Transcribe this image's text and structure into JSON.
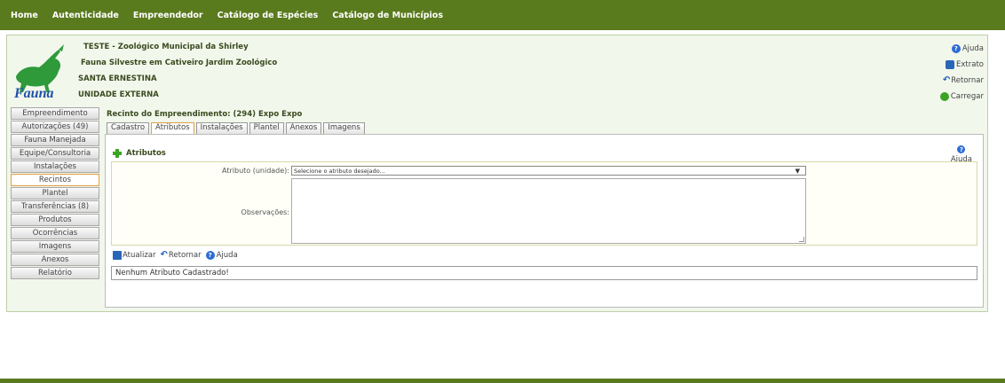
{
  "nav": [
    "Home",
    "Autenticidade",
    "Empreendedor",
    "Catálogo de Espécies",
    "Catálogo de Municípios"
  ],
  "header": {
    "line1": "TESTE - Zoológico Municipal da Shirley",
    "line2": "Fauna Silvestre em Cativeiro Jardim Zoológico",
    "line3": "SANTA ERNESTINA",
    "line4": "UNIDADE EXTERNA",
    "logo_text": "Fauna"
  },
  "right_actions": [
    "Ajuda",
    "Extrato",
    "Retornar",
    "Carregar"
  ],
  "sidebar": [
    "Empreendimento",
    "Autorizações (49)",
    "Fauna Manejada",
    "Equipe/Consultoria",
    "Instalações",
    "Recintos",
    "Plantel",
    "Transferências (8)",
    "Produtos",
    "Ocorrências",
    "Imagens",
    "Anexos",
    "Relatório"
  ],
  "sidebar_active": "Recintos",
  "recinto_title": "Recinto do Empreendimento: (294) Expo Expo",
  "tabs": [
    "Cadastro",
    "Atributos",
    "Instalações",
    "Plantel",
    "Anexos",
    "Imagens"
  ],
  "active_tab": "Atributos",
  "panel": {
    "title": "Atributos",
    "help": "Ajuda",
    "attr_label": "Atributo (unidade):",
    "attr_select": "Selecione o atributo desejado...",
    "obs_label": "Observações:",
    "actions": [
      "Atualizar",
      "Retornar",
      "Ajuda"
    ],
    "message": "Nenhum Atributo Cadastrado!"
  },
  "colors": {
    "nav_bg": "#5a7a1e",
    "accent": "#e0a040"
  }
}
